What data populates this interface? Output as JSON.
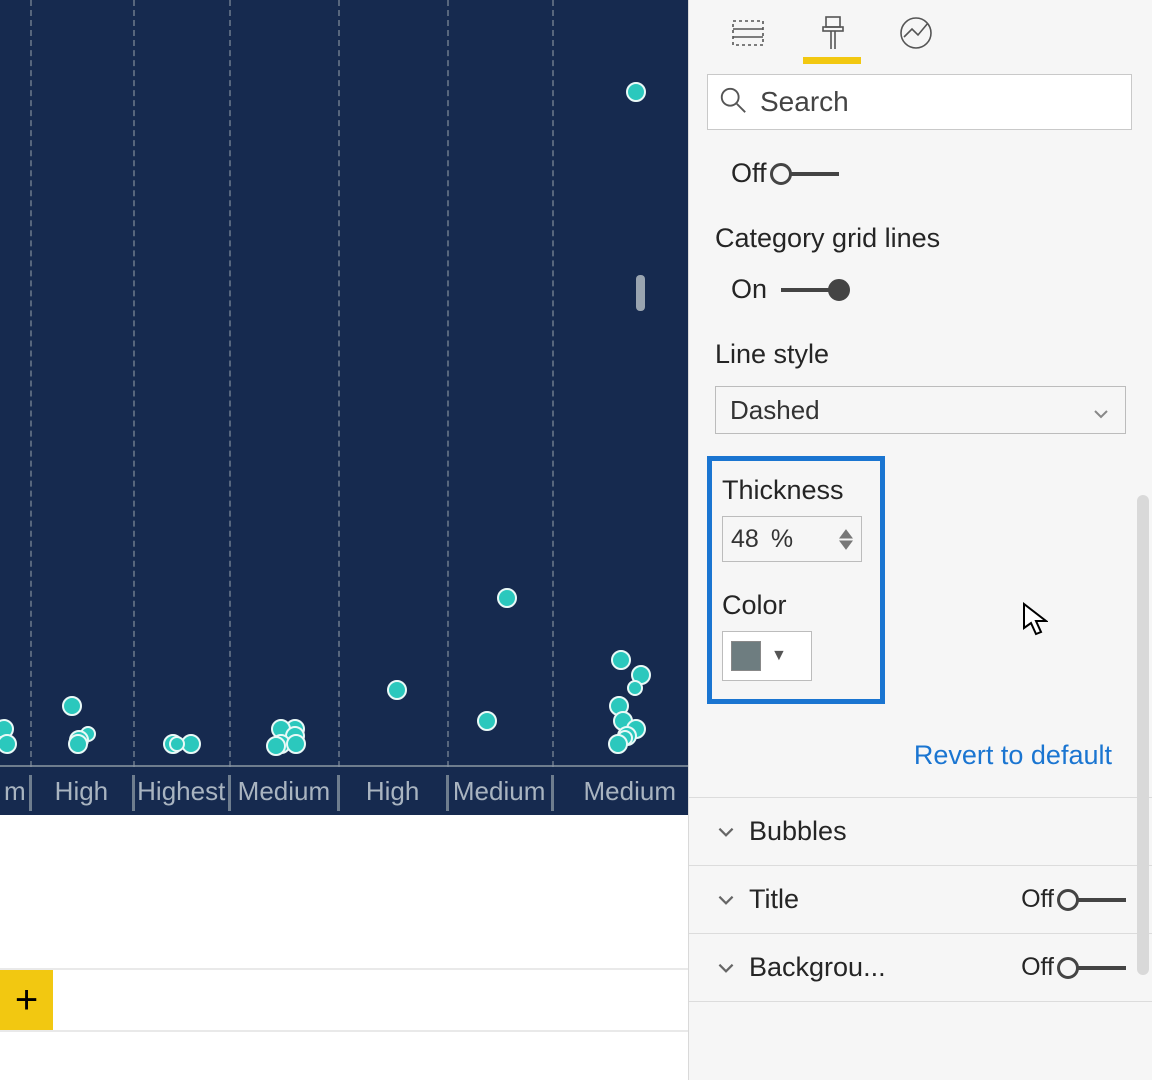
{
  "pane": {
    "search_placeholder": "Search",
    "prev_toggle_label": "Off",
    "category_gridlines": {
      "label": "Category grid lines",
      "on_label": "On"
    },
    "line_style": {
      "label": "Line style",
      "value": "Dashed"
    },
    "thickness": {
      "label": "Thickness",
      "value": "48",
      "unit": "%"
    },
    "color": {
      "label": "Color",
      "hex": "#6e7d80"
    },
    "revert": "Revert to default",
    "accordion": {
      "bubbles": "Bubbles",
      "title": {
        "label": "Title",
        "toggle": "Off"
      },
      "background": {
        "label": "Backgrou...",
        "toggle": "Off"
      }
    }
  },
  "add_tab": "+",
  "chart_data": {
    "type": "scatter",
    "categories": [
      "m",
      "High",
      "Highest",
      "Medium",
      "High",
      "Medium",
      "Medium"
    ],
    "category_gridline_x_pct": [
      4.2,
      18.8,
      32.4,
      47.8,
      63.1,
      77.9
    ],
    "ylim": [
      0,
      100
    ],
    "series": [
      {
        "name": "bubbles",
        "points": [
          {
            "cat": 0,
            "y": 5,
            "size": "md"
          },
          {
            "cat": 0,
            "y": 3,
            "size": "md"
          },
          {
            "cat": 1,
            "y": 8,
            "size": "md"
          },
          {
            "cat": 1,
            "y": 4,
            "size": "sm"
          },
          {
            "cat": 1,
            "y": 3.5,
            "size": "md"
          },
          {
            "cat": 1,
            "y": 3,
            "size": "md"
          },
          {
            "cat": 2,
            "y": 3,
            "size": "md"
          },
          {
            "cat": 2,
            "y": 3,
            "size": "md"
          },
          {
            "cat": 2,
            "y": 2.8,
            "size": "sm"
          },
          {
            "cat": 3,
            "y": 5,
            "size": "md"
          },
          {
            "cat": 3,
            "y": 5,
            "size": "md"
          },
          {
            "cat": 3,
            "y": 4,
            "size": "md"
          },
          {
            "cat": 3,
            "y": 3,
            "size": "md"
          },
          {
            "cat": 3,
            "y": 3,
            "size": "md"
          },
          {
            "cat": 3,
            "y": 2.8,
            "size": "md"
          },
          {
            "cat": 4,
            "y": 10,
            "size": "md"
          },
          {
            "cat": 5,
            "y": 22,
            "size": "md"
          },
          {
            "cat": 5,
            "y": 6,
            "size": "md"
          },
          {
            "cat": 6,
            "y": 88,
            "size": "md"
          },
          {
            "cat": 6,
            "y": 14,
            "size": "md"
          },
          {
            "cat": 6,
            "y": 12,
            "size": "md"
          },
          {
            "cat": 6,
            "y": 10,
            "size": "sm"
          },
          {
            "cat": 6,
            "y": 8,
            "size": "md"
          },
          {
            "cat": 6,
            "y": 6,
            "size": "md"
          },
          {
            "cat": 6,
            "y": 5,
            "size": "md"
          },
          {
            "cat": 6,
            "y": 4,
            "size": "md"
          },
          {
            "cat": 6,
            "y": 3.5,
            "size": "sm"
          },
          {
            "cat": 6,
            "y": 3,
            "size": "md"
          }
        ]
      }
    ]
  }
}
